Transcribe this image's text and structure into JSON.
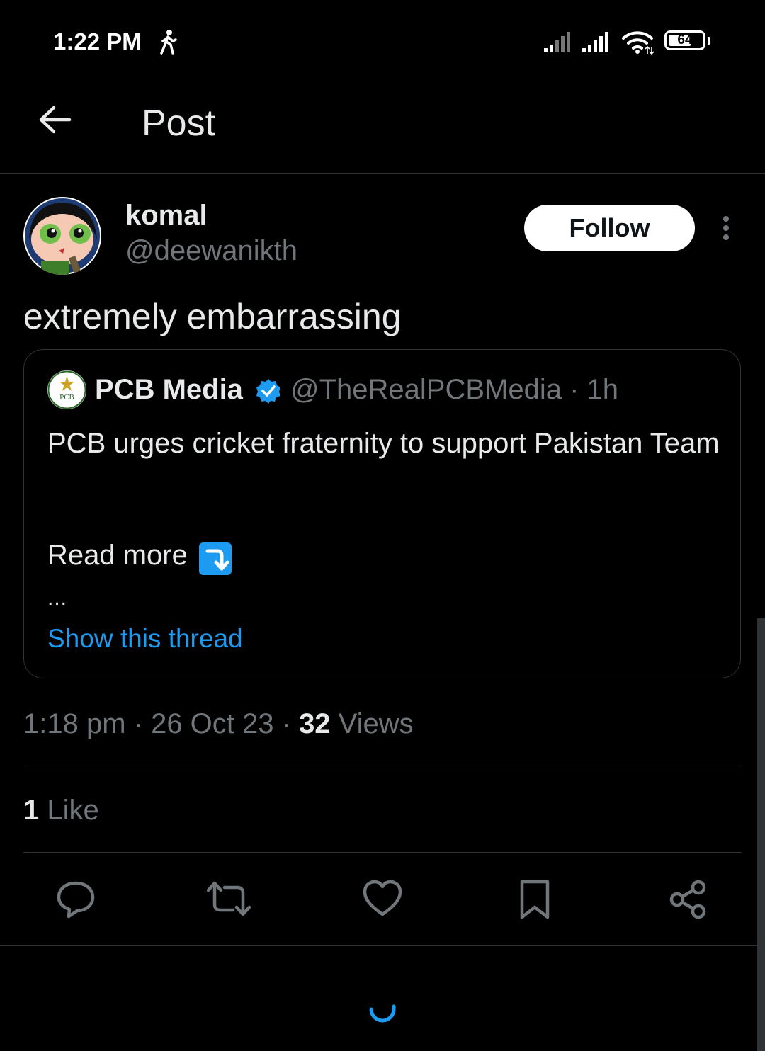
{
  "status_bar": {
    "time": "1:22 PM",
    "battery": "64"
  },
  "header": {
    "title": "Post"
  },
  "post": {
    "author_name": "komal",
    "author_handle": "@deewanikth",
    "follow_label": "Follow",
    "text": "extremely embarrassing",
    "quote": {
      "name": "PCB Media",
      "handle_time": "@TheRealPCBMedia · 1h",
      "avatar_text": "PCB",
      "text": "PCB urges cricket fraternity to support Pakistan Team",
      "read_more": "Read more",
      "ellipsis": "...",
      "show_thread": "Show this thread"
    },
    "meta": {
      "time_date": "1:18 pm · 26 Oct 23 · ",
      "views_count": "32",
      "views_label": " Views"
    },
    "likes": {
      "count": "1",
      "label": " Like"
    }
  },
  "colors": {
    "accent": "#1d9bf0",
    "background": "#000000",
    "secondary_text": "#71767b"
  }
}
